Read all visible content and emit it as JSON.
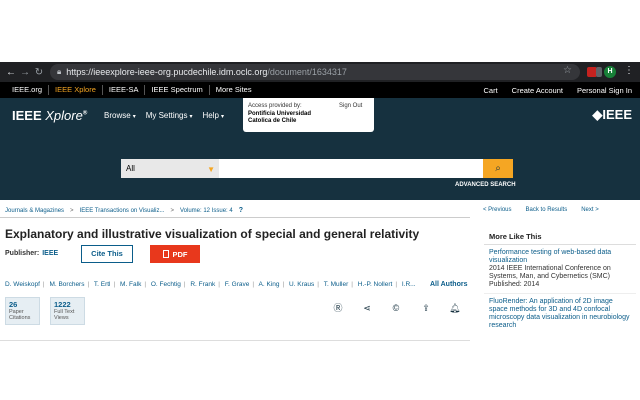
{
  "browser": {
    "url_host": "https://ieeexplore-ieee-org.pucdechile.idm.oclc.org",
    "url_path": "/document/1634317",
    "profile_initial": "H"
  },
  "topbar": {
    "links": [
      "IEEE.org",
      "IEEE Xplore",
      "IEEE-SA",
      "IEEE Spectrum",
      "More Sites"
    ],
    "right_links": [
      "Cart",
      "Create Account",
      "Personal Sign In"
    ]
  },
  "header": {
    "logo_main": "IEEE",
    "logo_italic": "Xplore",
    "logo_mark": "®",
    "menu": [
      "Browse",
      "My Settings",
      "Help"
    ],
    "access_label": "Access provided by:",
    "access_org": "Pontificia Universidad Catolica de Chile",
    "sign_out": "Sign Out",
    "ieee_logo": "◆IEEE"
  },
  "search": {
    "scope": "All",
    "placeholder": "",
    "advanced": "ADVANCED SEARCH"
  },
  "breadcrumb": {
    "items": [
      "Journals & Magazines",
      "IEEE Transactions on Visualiz...",
      "Volume: 12 Issue: 4"
    ]
  },
  "right_nav": {
    "prev": "< Previous",
    "back": "Back to Results",
    "next": "Next >"
  },
  "article": {
    "title": "Explanatory and illustrative visualization of special and general relativity",
    "publisher_label": "Publisher:",
    "publisher": "IEEE",
    "cite_label": "Cite This",
    "pdf_label": "PDF",
    "authors": [
      "D. Weiskopf",
      "M. Borchers",
      "T. Ertl",
      "M. Falk",
      "O. Fechtig",
      "R. Frank",
      "F. Grave",
      "A. King",
      "U. Kraus",
      "T. Muller",
      "H.-P. Nollert",
      "I.R..."
    ],
    "all_authors": "All Authors",
    "metrics": [
      {
        "num": "26",
        "label": "Paper Citations"
      },
      {
        "num": "1222",
        "label": "Full Text Views"
      }
    ]
  },
  "sidebar": {
    "heading": "More Like This",
    "items": [
      {
        "title": "Performance testing of web-based data visualization",
        "meta": "2014 IEEE International Conference on Systems, Man, and Cybernetics (SMC)",
        "published": "Published: 2014"
      },
      {
        "title": "FluoRender: An application of 2D image space methods for 3D and 4D confocal microscopy data visualization in neurobiology research",
        "meta": "",
        "published": ""
      }
    ]
  }
}
